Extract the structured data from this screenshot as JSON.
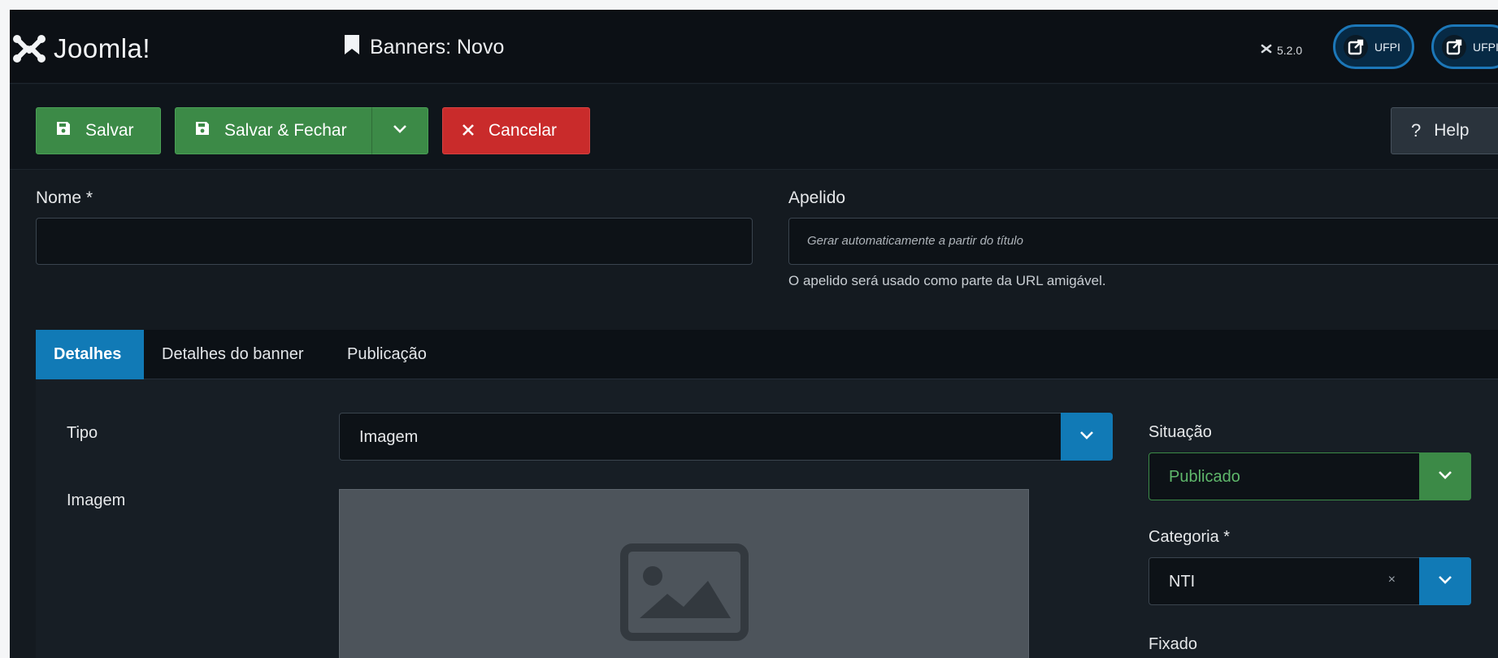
{
  "header": {
    "logo_text": "Joomla!",
    "page_title": "Banners: Novo",
    "version": "5.2.0",
    "site_links": [
      {
        "label": "UFPI"
      },
      {
        "label": "UFPI"
      }
    ]
  },
  "toolbar": {
    "save_label": "Salvar",
    "save_close_label": "Salvar & Fechar",
    "cancel_label": "Cancelar",
    "help_label": "Help"
  },
  "form": {
    "name_label": "Nome *",
    "name_value": "",
    "alias_label": "Apelido",
    "alias_placeholder": "Gerar automaticamente a partir do título",
    "alias_help": "O apelido será usado como parte da URL amigável."
  },
  "tabs": [
    {
      "label": "Detalhes",
      "active": true
    },
    {
      "label": "Detalhes do banner",
      "active": false
    },
    {
      "label": "Publicação",
      "active": false
    }
  ],
  "details": {
    "type_label": "Tipo",
    "type_value": "Imagem",
    "image_label": "Imagem",
    "status_label": "Situação",
    "status_value": "Publicado",
    "category_label": "Categoria *",
    "category_value": "NTI",
    "pinned_label": "Fixado"
  },
  "colors": {
    "accent": "#117ab6",
    "success": "#3c8a47",
    "danger": "#c92b2b",
    "background": "#141a20"
  }
}
